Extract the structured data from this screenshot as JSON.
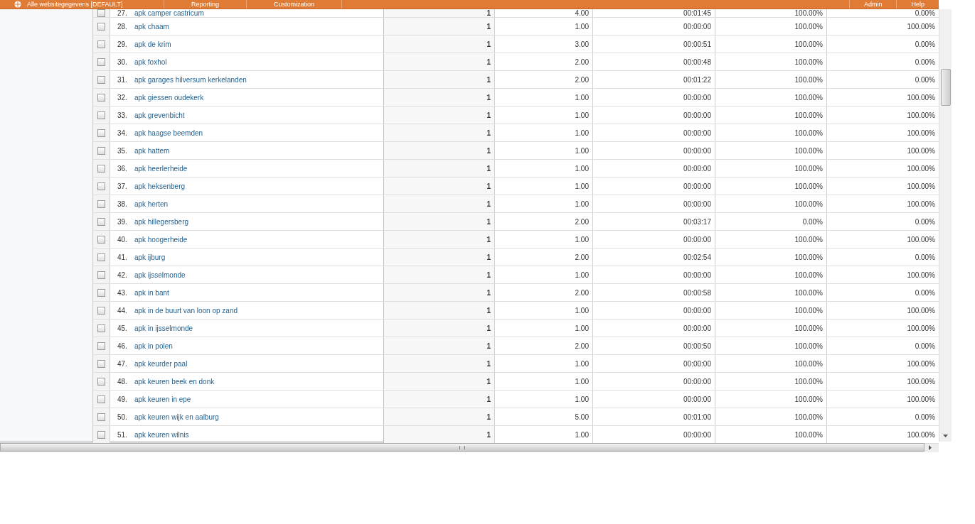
{
  "top_nav": {
    "account": "Alle websitegegevens [DEFAULT]",
    "tabs": [
      "Reporting",
      "Customization"
    ],
    "links": [
      "Admin",
      "Help"
    ]
  },
  "table": {
    "rows": [
      {
        "index": "27.",
        "keyword": "apk camper castricum",
        "checked": false,
        "values": [
          "1",
          "4.00",
          "00:01:45",
          "100.00%",
          "0.00%"
        ]
      },
      {
        "index": "28.",
        "keyword": "apk chaam",
        "checked": false,
        "values": [
          "1",
          "1.00",
          "00:00:00",
          "100.00%",
          "100.00%"
        ]
      },
      {
        "index": "29.",
        "keyword": "apk de krim",
        "checked": false,
        "values": [
          "1",
          "3.00",
          "00:00:51",
          "100.00%",
          "0.00%"
        ]
      },
      {
        "index": "30.",
        "keyword": "apk foxhol",
        "checked": false,
        "values": [
          "1",
          "2.00",
          "00:00:48",
          "100.00%",
          "0.00%"
        ]
      },
      {
        "index": "31.",
        "keyword": "apk garages hilversum kerkelanden",
        "checked": false,
        "values": [
          "1",
          "2.00",
          "00:01:22",
          "100.00%",
          "0.00%"
        ]
      },
      {
        "index": "32.",
        "keyword": "apk giessen oudekerk",
        "checked": false,
        "values": [
          "1",
          "1.00",
          "00:00:00",
          "100.00%",
          "100.00%"
        ]
      },
      {
        "index": "33.",
        "keyword": "apk grevenbicht",
        "checked": false,
        "values": [
          "1",
          "1.00",
          "00:00:00",
          "100.00%",
          "100.00%"
        ]
      },
      {
        "index": "34.",
        "keyword": "apk haagse beemden",
        "checked": false,
        "values": [
          "1",
          "1.00",
          "00:00:00",
          "100.00%",
          "100.00%"
        ]
      },
      {
        "index": "35.",
        "keyword": "apk hattem",
        "checked": false,
        "values": [
          "1",
          "1.00",
          "00:00:00",
          "100.00%",
          "100.00%"
        ]
      },
      {
        "index": "36.",
        "keyword": "apk heerlerheide",
        "checked": false,
        "values": [
          "1",
          "1.00",
          "00:00:00",
          "100.00%",
          "100.00%"
        ]
      },
      {
        "index": "37.",
        "keyword": "apk heksenberg",
        "checked": false,
        "values": [
          "1",
          "1.00",
          "00:00:00",
          "100.00%",
          "100.00%"
        ]
      },
      {
        "index": "38.",
        "keyword": "apk herten",
        "checked": false,
        "values": [
          "1",
          "1.00",
          "00:00:00",
          "100.00%",
          "100.00%"
        ]
      },
      {
        "index": "39.",
        "keyword": "apk hillegersberg",
        "checked": false,
        "values": [
          "1",
          "2.00",
          "00:03:17",
          "0.00%",
          "0.00%"
        ]
      },
      {
        "index": "40.",
        "keyword": "apk hoogerheide",
        "checked": false,
        "values": [
          "1",
          "1.00",
          "00:00:00",
          "100.00%",
          "100.00%"
        ]
      },
      {
        "index": "41.",
        "keyword": "apk ijburg",
        "checked": false,
        "values": [
          "1",
          "2.00",
          "00:02:54",
          "100.00%",
          "0.00%"
        ]
      },
      {
        "index": "42.",
        "keyword": "apk ijsselmonde",
        "checked": false,
        "values": [
          "1",
          "1.00",
          "00:00:00",
          "100.00%",
          "100.00%"
        ]
      },
      {
        "index": "43.",
        "keyword": "apk in bant",
        "checked": false,
        "values": [
          "1",
          "2.00",
          "00:00:58",
          "100.00%",
          "0.00%"
        ]
      },
      {
        "index": "44.",
        "keyword": "apk in de buurt van loon op zand",
        "checked": false,
        "values": [
          "1",
          "1.00",
          "00:00:00",
          "100.00%",
          "100.00%"
        ]
      },
      {
        "index": "45.",
        "keyword": "apk in ijsselmonde",
        "checked": false,
        "values": [
          "1",
          "1.00",
          "00:00:00",
          "100.00%",
          "100.00%"
        ]
      },
      {
        "index": "46.",
        "keyword": "apk in polen",
        "checked": false,
        "values": [
          "1",
          "2.00",
          "00:00:50",
          "100.00%",
          "0.00%"
        ]
      },
      {
        "index": "47.",
        "keyword": "apk keurder paal",
        "checked": false,
        "values": [
          "1",
          "1.00",
          "00:00:00",
          "100.00%",
          "100.00%"
        ]
      },
      {
        "index": "48.",
        "keyword": "apk keuren beek en donk",
        "checked": false,
        "values": [
          "1",
          "1.00",
          "00:00:00",
          "100.00%",
          "100.00%"
        ]
      },
      {
        "index": "49.",
        "keyword": "apk keuren in epe",
        "checked": false,
        "values": [
          "1",
          "1.00",
          "00:00:00",
          "100.00%",
          "100.00%"
        ]
      },
      {
        "index": "50.",
        "keyword": "apk keuren wijk en aalburg",
        "checked": false,
        "values": [
          "1",
          "5.00",
          "00:01:00",
          "100.00%",
          "0.00%"
        ]
      },
      {
        "index": "51.",
        "keyword": "apk keuren wilnis",
        "checked": false,
        "values": [
          "1",
          "1.00",
          "00:00:00",
          "100.00%",
          "100.00%"
        ]
      }
    ]
  }
}
